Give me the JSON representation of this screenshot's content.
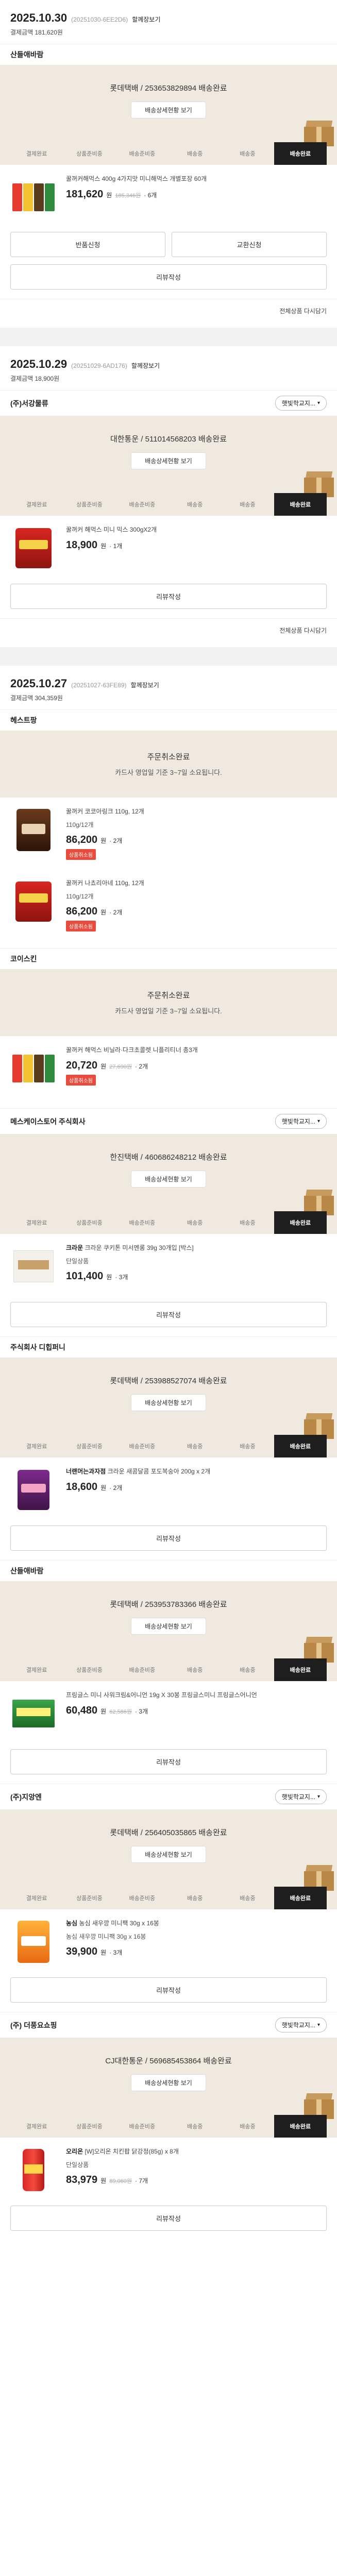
{
  "common": {
    "detail_link": "할께장보기",
    "track_button": "배송상세현황 보기",
    "review_button": "리뷰작성",
    "share_chip": "햇빛학교지...",
    "won": "원",
    "steps": [
      "결제완료",
      "상품준비중",
      "배송준비중",
      "배송중",
      "배송중",
      "배송완료"
    ]
  },
  "orders": [
    {
      "date": "2025.10.30",
      "order_no": "(20251030-6EE2D6)",
      "payment": "결제금액 181,620원",
      "footer": "전체상품 다시담기",
      "groups": [
        {
          "seller": "산들애바람",
          "show_chip": false,
          "ship_main": "롯데택배 / 253653829894 배송완료",
          "ship_sub": "",
          "wait": false,
          "items": [
            {
              "brand": "",
              "name": "꿀꺼커해먹스 400g 4가지맛 미니해먹스 개별포장 60개",
              "option": "",
              "price": "181,620",
              "orig": "185,346원",
              "qty": "6개",
              "badge": "",
              "art": "p-box-multi"
            }
          ],
          "buttons": [
            "반품신청",
            "교환신청"
          ]
        }
      ]
    },
    {
      "date": "2025.10.29",
      "order_no": "(20251029-6AD176)",
      "payment": "결제금액 18,900원",
      "footer": "전체상품 다시담기",
      "groups": [
        {
          "seller": "(주)서강물류",
          "show_chip": true,
          "ship_main": "대한통운 / 511014568203 배송완료",
          "ship_sub": "",
          "wait": false,
          "items": [
            {
              "brand": "",
              "name": "꿀꺼커 해먹스 미니 믹스 300gX2개",
              "option": "",
              "price": "18,900",
              "orig": "",
              "qty": "1개",
              "badge": "",
              "art": "p-bag-red"
            }
          ],
          "buttons": []
        }
      ]
    },
    {
      "date": "2025.10.27",
      "order_no": "(20251027-63FE89)",
      "payment": "결제금액 304,359원",
      "footer": "",
      "groups": [
        {
          "seller": "헤스트팡",
          "show_chip": false,
          "ship_main": "주문취소완료",
          "ship_sub": "카드사 영업일 기준 3~7일 소요됩니다.",
          "wait": true,
          "items": [
            {
              "brand": "",
              "name": "꿀꺼커 코코아링크 110g, 12개",
              "option": "110g/12개",
              "price": "86,200",
              "orig": "",
              "qty": "2개",
              "badge": "상품취소됨",
              "art": "p-bag-brown"
            },
            {
              "brand": "",
              "name": "꿀꺼커 나쵸리아네 110g, 12개",
              "option": "110g/12개",
              "price": "86,200",
              "orig": "",
              "qty": "2개",
              "badge": "상품취소됨",
              "art": "p-bag-red"
            }
          ],
          "buttons": []
        },
        {
          "seller": "코이스킨",
          "show_chip": false,
          "ship_main": "주문취소완료",
          "ship_sub": "카드사 영업일 기준 3~7일 소요됩니다.",
          "wait": true,
          "items": [
            {
              "brand": "",
              "name": "꿀꺼커 해먹스 비닐라·다크초콜렛 니플리티너 총3개",
              "option": "",
              "price": "20,720",
              "orig": "27,690원",
              "qty": "2개",
              "badge": "상품취소됨",
              "art": "p-box-multi"
            }
          ],
          "buttons": []
        },
        {
          "seller": "메스케이스토어 주식회사",
          "show_chip": true,
          "ship_main": "한진택배 / 460686248212 배송완료",
          "ship_sub": "",
          "wait": false,
          "items": [
            {
              "brand": "크라운",
              "name": "크라운 쿠키톤 미서멘롱 39g 30개입 [박스]",
              "option": "단일상품",
              "price": "101,400",
              "orig": "",
              "qty": "3개",
              "badge": "",
              "art": "p-box-white"
            }
          ],
          "buttons": []
        },
        {
          "seller": "주식회사 디힙퍼니",
          "show_chip": false,
          "ship_main": "롯데택배 / 253988527074 배송완료",
          "ship_sub": "",
          "wait": false,
          "items": [
            {
              "brand": "너랜머는과자점",
              "name": "크라운 새콤달콤 포도복숭아 200g x 2개",
              "option": "",
              "price": "18,600",
              "orig": "",
              "qty": "2개",
              "badge": "",
              "art": "p-bag-purple"
            }
          ],
          "buttons": []
        },
        {
          "seller": "산들애바람",
          "show_chip": false,
          "ship_main": "롯데택배 / 253953783366 배송완료",
          "ship_sub": "",
          "wait": false,
          "items": [
            {
              "brand": "",
              "name": "프링글스 미니 사워크림&어니언 19g X 30봉 프링글스미니 프링글스어니언",
              "option": "",
              "price": "60,480",
              "orig": "62,586원",
              "qty": "3개",
              "badge": "",
              "art": "p-box-green"
            }
          ],
          "buttons": []
        },
        {
          "seller": "(주)지앙엔",
          "show_chip": true,
          "ship_main": "롯데택배 / 256405035865 배송완료",
          "ship_sub": "",
          "wait": false,
          "items": [
            {
              "brand": "농심",
              "name": "농심 새우깡 미니팩 30g x 16봉",
              "option": "농심 새우깡 미니팩 30g x 16봉",
              "price": "39,900",
              "orig": "",
              "qty": "3개",
              "badge": "",
              "art": "p-bag-orange"
            }
          ],
          "buttons": []
        },
        {
          "seller": "(주) 더풍요쇼핑",
          "show_chip": true,
          "ship_main": "CJ대한통운 / 569685453864 배송완료",
          "ship_sub": "",
          "wait": false,
          "items": [
            {
              "brand": "오리온",
              "name": "[W]오리온 치킨팝 닭강정(85g) x 8개",
              "option": "단일상품",
              "price": "83,979",
              "orig": "89,060원",
              "qty": "7개",
              "badge": "",
              "art": "p-can"
            }
          ],
          "buttons": []
        }
      ]
    }
  ]
}
